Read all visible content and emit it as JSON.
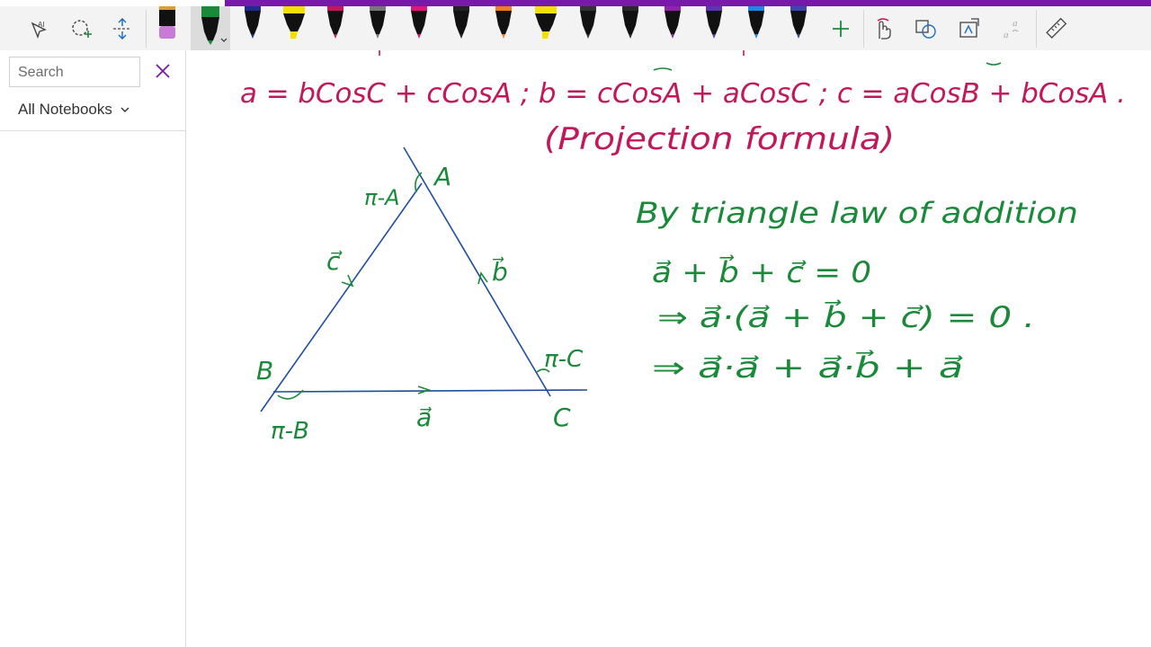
{
  "sidebar": {
    "search_placeholder": "Search",
    "notebooks_label": "All Notebooks"
  },
  "canvas": {
    "formula_line": "a = bCosC + cCosA ;  b = cCosA + aCosC ;  c = aCosB + bCosA .",
    "projection_label": "(Projection formula)",
    "triangle_labels": {
      "vertex_a": "A",
      "vertex_b": "B",
      "vertex_c": "C",
      "angle_a": "π-A",
      "angle_b": "π-B",
      "angle_c": "π-C",
      "side_a": "a⃗",
      "side_b": "b⃗",
      "side_c": "c⃗"
    },
    "notes": [
      "By triangle law of addition",
      "a⃗ + b⃗ + c⃗ = 0",
      "⇒ a⃗·(a⃗ + b⃗ + c⃗) = 0 .",
      "⇒ a⃗·a⃗ + a⃗·b⃗ + a⃗"
    ]
  },
  "colors": {
    "accent": "#7719aa",
    "ink_magenta": "#c2185b",
    "ink_green": "#1a8a3a",
    "ink_blue": "#1f4e9c"
  },
  "icons": {
    "lasso": "lasso-select-icon",
    "shapes": "shape-select-icon",
    "insert_space": "insert-space-icon",
    "add_pen": "plus-icon",
    "touch_draw": "touch-draw-icon",
    "ink_to_shape": "ink-to-shape-icon",
    "ink_to_text": "ink-to-text-icon",
    "math": "ink-math-icon",
    "ruler": "ruler-icon"
  }
}
